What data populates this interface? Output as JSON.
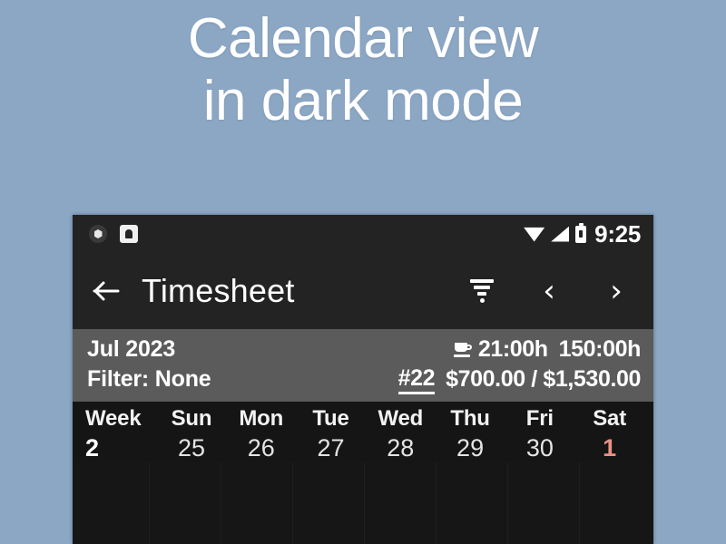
{
  "poster": {
    "background_color": "#8ca7c4",
    "headline_lines": [
      "Calendar view",
      "in dark mode"
    ],
    "headline_color": "#ffffff"
  },
  "phone": {
    "status_bar": {
      "background_color": "#232323",
      "left_icons": [
        "notification-badge-icon",
        "notification-square-icon"
      ],
      "right_icons": [
        "wifi-icon",
        "cellular-signal-icon",
        "battery-icon"
      ],
      "time": "9:25"
    },
    "app_bar": {
      "background_color": "#232323",
      "back_icon": "back-arrow-icon",
      "title": "Timesheet",
      "filter_icon": "filter-funnel-icon",
      "prev_label": "‹",
      "next_label": "›"
    },
    "summary": {
      "background_color": "#5b5b5b",
      "month": "Jul 2023",
      "filter": "Filter: None",
      "break_icon": "coffee-cup-icon",
      "hours_worked": "21:00h",
      "hours_target": "150:00h",
      "entry_count": "#22",
      "earnings": "$700.00 / $1,530.00"
    },
    "calendar": {
      "background_color": "#151515",
      "accent_weekend_color": "#e99286",
      "columns": [
        {
          "header": "Week",
          "day": "2",
          "weekend": false,
          "first": true
        },
        {
          "header": "Sun",
          "day": "25",
          "weekend": false,
          "first": false
        },
        {
          "header": "Mon",
          "day": "26",
          "weekend": false,
          "first": false
        },
        {
          "header": "Tue",
          "day": "27",
          "weekend": false,
          "first": false
        },
        {
          "header": "Wed",
          "day": "28",
          "weekend": false,
          "first": false
        },
        {
          "header": "Thu",
          "day": "29",
          "weekend": false,
          "first": false
        },
        {
          "header": "Fri",
          "day": "30",
          "weekend": false,
          "first": false
        },
        {
          "header": "Sat",
          "day": "1",
          "weekend": true,
          "first": false
        }
      ]
    }
  }
}
